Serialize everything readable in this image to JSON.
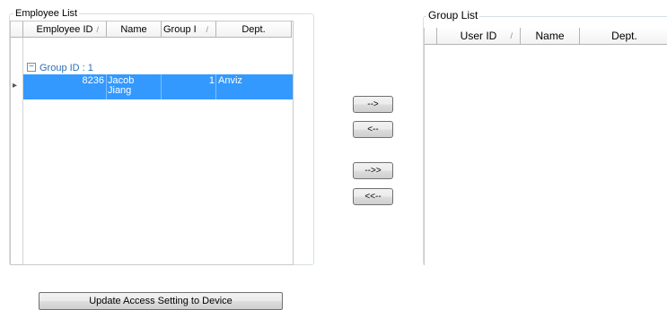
{
  "employee_list": {
    "title": "Employee List",
    "columns": [
      "Employee ID",
      "Name",
      "Group I",
      "Dept."
    ],
    "group_row": {
      "label": "Group ID : 1",
      "expander": "−"
    },
    "rows": [
      {
        "employee_id": "8236",
        "name_line1": "Jacob",
        "name_line2": "Jiang",
        "group_id": "1",
        "dept": "Anviz"
      }
    ],
    "row_indicator": "▸"
  },
  "transfer_buttons": {
    "move_right": "-->",
    "move_left": "<--",
    "move_all_right": "-->>",
    "move_all_left": "<<--"
  },
  "group_list": {
    "title": "Group List",
    "columns": [
      "User ID",
      "Name",
      "Dept."
    ]
  },
  "update_button": "Update Access Setting to Device",
  "colors": {
    "selection": "#3399ff",
    "group_label": "#2b6fb6",
    "groupbox_border": "#d5dfe5"
  },
  "icons": {
    "sort": "sort-indicator-icon",
    "expander": "collapse-group-icon",
    "row_pointer": "current-row-pointer-icon"
  }
}
